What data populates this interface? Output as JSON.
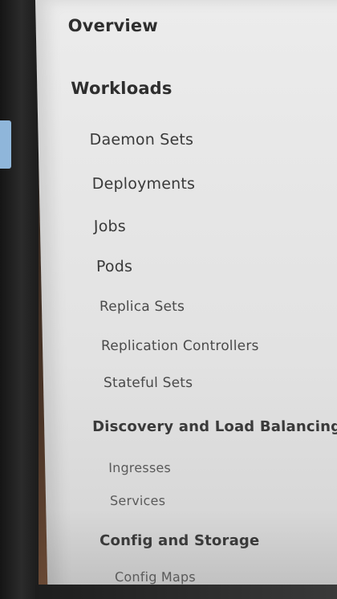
{
  "sidebar": {
    "overview": "Overview",
    "workloads": {
      "label": "Workloads",
      "items": [
        "Daemon Sets",
        "Deployments",
        "Jobs",
        "Pods",
        "Replica Sets",
        "Replication Controllers",
        "Stateful Sets"
      ]
    },
    "discovery": {
      "label": "Discovery and Load Balancing",
      "items": [
        "Ingresses",
        "Services"
      ]
    },
    "config": {
      "label": "Config and Storage",
      "items": [
        "Config Maps"
      ]
    }
  }
}
